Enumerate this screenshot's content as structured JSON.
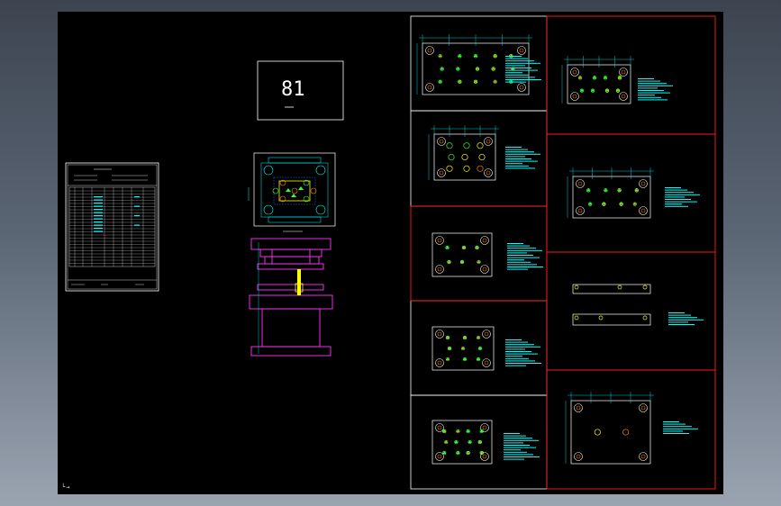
{
  "colors": {
    "background": "#000000",
    "sheet_white": "#ffffff",
    "sheet_red": "#ff1a1a",
    "dimension_cyan": "#00ffff",
    "part_green": "#33ff33",
    "part_yellow": "#ffff00",
    "part_orange": "#ff8800",
    "side_view_magenta": "#ff33ff",
    "hidden_blue": "#3355ff"
  },
  "icons": {
    "ucs": "ucs-axis-icon"
  },
  "title_block": {
    "code": "81"
  }
}
